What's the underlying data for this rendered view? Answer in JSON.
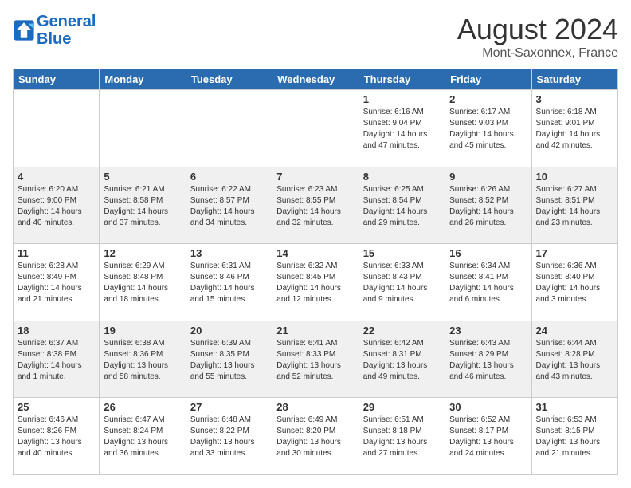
{
  "header": {
    "logo_line1": "General",
    "logo_line2": "Blue",
    "month_year": "August 2024",
    "location": "Mont-Saxonnex, France"
  },
  "weekdays": [
    "Sunday",
    "Monday",
    "Tuesday",
    "Wednesday",
    "Thursday",
    "Friday",
    "Saturday"
  ],
  "weeks": [
    [
      {
        "day": "",
        "info": ""
      },
      {
        "day": "",
        "info": ""
      },
      {
        "day": "",
        "info": ""
      },
      {
        "day": "",
        "info": ""
      },
      {
        "day": "1",
        "info": "Sunrise: 6:16 AM\nSunset: 9:04 PM\nDaylight: 14 hours\nand 47 minutes."
      },
      {
        "day": "2",
        "info": "Sunrise: 6:17 AM\nSunset: 9:03 PM\nDaylight: 14 hours\nand 45 minutes."
      },
      {
        "day": "3",
        "info": "Sunrise: 6:18 AM\nSunset: 9:01 PM\nDaylight: 14 hours\nand 42 minutes."
      }
    ],
    [
      {
        "day": "4",
        "info": "Sunrise: 6:20 AM\nSunset: 9:00 PM\nDaylight: 14 hours\nand 40 minutes."
      },
      {
        "day": "5",
        "info": "Sunrise: 6:21 AM\nSunset: 8:58 PM\nDaylight: 14 hours\nand 37 minutes."
      },
      {
        "day": "6",
        "info": "Sunrise: 6:22 AM\nSunset: 8:57 PM\nDaylight: 14 hours\nand 34 minutes."
      },
      {
        "day": "7",
        "info": "Sunrise: 6:23 AM\nSunset: 8:55 PM\nDaylight: 14 hours\nand 32 minutes."
      },
      {
        "day": "8",
        "info": "Sunrise: 6:25 AM\nSunset: 8:54 PM\nDaylight: 14 hours\nand 29 minutes."
      },
      {
        "day": "9",
        "info": "Sunrise: 6:26 AM\nSunset: 8:52 PM\nDaylight: 14 hours\nand 26 minutes."
      },
      {
        "day": "10",
        "info": "Sunrise: 6:27 AM\nSunset: 8:51 PM\nDaylight: 14 hours\nand 23 minutes."
      }
    ],
    [
      {
        "day": "11",
        "info": "Sunrise: 6:28 AM\nSunset: 8:49 PM\nDaylight: 14 hours\nand 21 minutes."
      },
      {
        "day": "12",
        "info": "Sunrise: 6:29 AM\nSunset: 8:48 PM\nDaylight: 14 hours\nand 18 minutes."
      },
      {
        "day": "13",
        "info": "Sunrise: 6:31 AM\nSunset: 8:46 PM\nDaylight: 14 hours\nand 15 minutes."
      },
      {
        "day": "14",
        "info": "Sunrise: 6:32 AM\nSunset: 8:45 PM\nDaylight: 14 hours\nand 12 minutes."
      },
      {
        "day": "15",
        "info": "Sunrise: 6:33 AM\nSunset: 8:43 PM\nDaylight: 14 hours\nand 9 minutes."
      },
      {
        "day": "16",
        "info": "Sunrise: 6:34 AM\nSunset: 8:41 PM\nDaylight: 14 hours\nand 6 minutes."
      },
      {
        "day": "17",
        "info": "Sunrise: 6:36 AM\nSunset: 8:40 PM\nDaylight: 14 hours\nand 3 minutes."
      }
    ],
    [
      {
        "day": "18",
        "info": "Sunrise: 6:37 AM\nSunset: 8:38 PM\nDaylight: 14 hours\nand 1 minute."
      },
      {
        "day": "19",
        "info": "Sunrise: 6:38 AM\nSunset: 8:36 PM\nDaylight: 13 hours\nand 58 minutes."
      },
      {
        "day": "20",
        "info": "Sunrise: 6:39 AM\nSunset: 8:35 PM\nDaylight: 13 hours\nand 55 minutes."
      },
      {
        "day": "21",
        "info": "Sunrise: 6:41 AM\nSunset: 8:33 PM\nDaylight: 13 hours\nand 52 minutes."
      },
      {
        "day": "22",
        "info": "Sunrise: 6:42 AM\nSunset: 8:31 PM\nDaylight: 13 hours\nand 49 minutes."
      },
      {
        "day": "23",
        "info": "Sunrise: 6:43 AM\nSunset: 8:29 PM\nDaylight: 13 hours\nand 46 minutes."
      },
      {
        "day": "24",
        "info": "Sunrise: 6:44 AM\nSunset: 8:28 PM\nDaylight: 13 hours\nand 43 minutes."
      }
    ],
    [
      {
        "day": "25",
        "info": "Sunrise: 6:46 AM\nSunset: 8:26 PM\nDaylight: 13 hours\nand 40 minutes."
      },
      {
        "day": "26",
        "info": "Sunrise: 6:47 AM\nSunset: 8:24 PM\nDaylight: 13 hours\nand 36 minutes."
      },
      {
        "day": "27",
        "info": "Sunrise: 6:48 AM\nSunset: 8:22 PM\nDaylight: 13 hours\nand 33 minutes."
      },
      {
        "day": "28",
        "info": "Sunrise: 6:49 AM\nSunset: 8:20 PM\nDaylight: 13 hours\nand 30 minutes."
      },
      {
        "day": "29",
        "info": "Sunrise: 6:51 AM\nSunset: 8:18 PM\nDaylight: 13 hours\nand 27 minutes."
      },
      {
        "day": "30",
        "info": "Sunrise: 6:52 AM\nSunset: 8:17 PM\nDaylight: 13 hours\nand 24 minutes."
      },
      {
        "day": "31",
        "info": "Sunrise: 6:53 AM\nSunset: 8:15 PM\nDaylight: 13 hours\nand 21 minutes."
      }
    ]
  ]
}
